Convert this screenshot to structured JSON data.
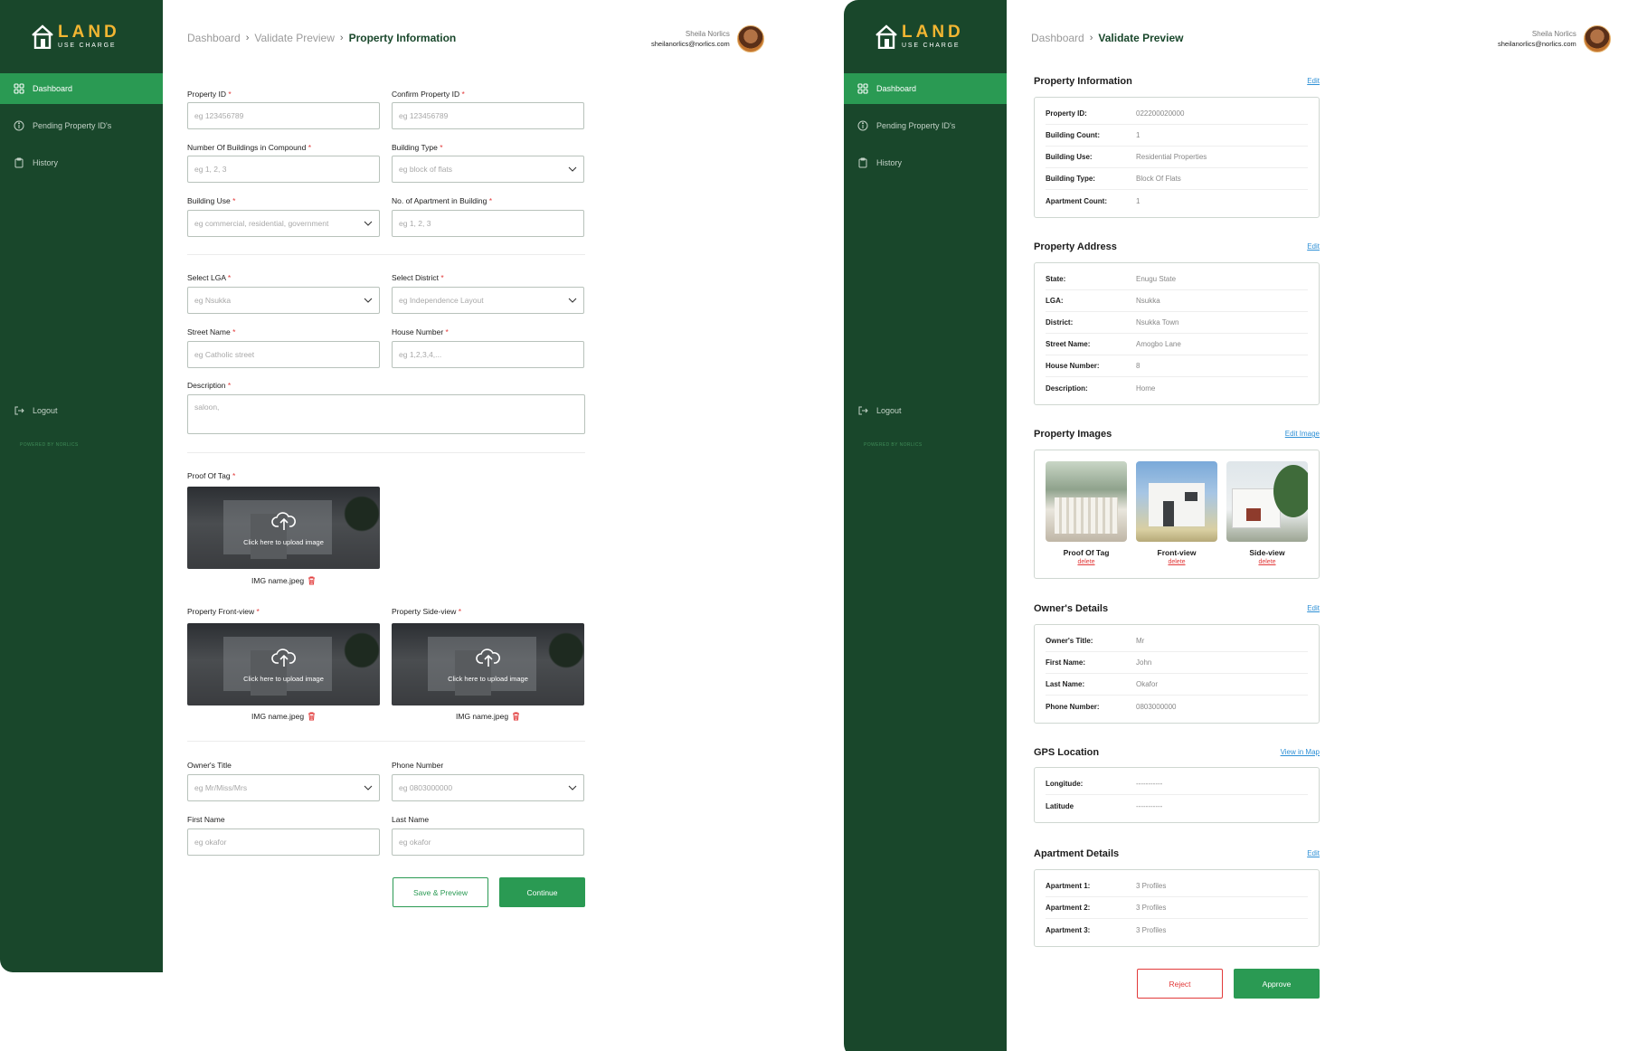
{
  "brand": {
    "title": "LAND",
    "subtitle": "USE CHARGE",
    "powered_by": "POWERED BY NORLICS"
  },
  "sidebar": {
    "items": [
      {
        "label": "Dashboard",
        "icon": "grid-icon"
      },
      {
        "label": "Pending Property ID's",
        "icon": "info-icon"
      },
      {
        "label": "History",
        "icon": "clipboard-icon"
      }
    ],
    "logout": "Logout"
  },
  "user": {
    "name": "Sheila Norlics",
    "email": "sheilanorlics@norlics.com"
  },
  "form_page": {
    "breadcrumb": [
      "Dashboard",
      "Validate Preview",
      "Property Information"
    ],
    "fields": {
      "property_id": {
        "label": "Property ID",
        "placeholder": "eg 123456789"
      },
      "confirm_property_id": {
        "label": "Confirm Property ID",
        "placeholder": "eg 123456789"
      },
      "num_buildings": {
        "label": "Number Of Buildings in Compound",
        "placeholder": "eg 1, 2, 3"
      },
      "building_type": {
        "label": "Building Type",
        "placeholder": "eg block of flats"
      },
      "building_use": {
        "label": "Building Use",
        "placeholder": "eg commercial, residential, government"
      },
      "num_apartments": {
        "label": "No. of Apartment in Building",
        "placeholder": "eg 1, 2, 3"
      },
      "lga": {
        "label": "Select LGA",
        "placeholder": "eg Nsukka"
      },
      "district": {
        "label": "Select District",
        "placeholder": "eg Independence Layout"
      },
      "street": {
        "label": "Street Name",
        "placeholder": "eg Catholic street"
      },
      "house_number": {
        "label": "House Number",
        "placeholder": "eg 1,2,3,4,..."
      },
      "description": {
        "label": "Description",
        "placeholder": "saloon,"
      },
      "owner_title": {
        "label": "Owner's Title",
        "placeholder": "eg Mr/Miss/Mrs"
      },
      "phone": {
        "label": "Phone Number",
        "placeholder": "eg 0803000000"
      },
      "first_name": {
        "label": "First Name",
        "placeholder": "eg okafor"
      },
      "last_name": {
        "label": "Last Name",
        "placeholder": "eg okafor"
      }
    },
    "uploads": {
      "proof_of_tag": {
        "label": "Proof Of Tag",
        "hint": "Click here to upload image",
        "file": "IMG name.jpeg"
      },
      "front_view": {
        "label": "Property Front-view",
        "hint": "Click here to upload image",
        "file": "IMG name.jpeg"
      },
      "side_view": {
        "label": "Property Side-view",
        "hint": "Click here to upload image",
        "file": "IMG name.jpeg"
      }
    },
    "required_mark": "*",
    "buttons": {
      "save_preview": "Save & Preview",
      "continue": "Continue"
    }
  },
  "preview_page": {
    "breadcrumb": [
      "Dashboard",
      "Validate Preview"
    ],
    "property_info": {
      "title": "Property Information",
      "action": "Edit",
      "rows": [
        {
          "k": "Property ID:",
          "v": "022200020000"
        },
        {
          "k": "Building Count:",
          "v": "1"
        },
        {
          "k": "Building Use:",
          "v": "Residential Properties"
        },
        {
          "k": "Building Type:",
          "v": "Block Of Flats"
        },
        {
          "k": "Apartment Count:",
          "v": "1"
        }
      ]
    },
    "property_address": {
      "title": "Property Address",
      "action": "Edit",
      "rows": [
        {
          "k": "State:",
          "v": "Enugu State"
        },
        {
          "k": "LGA:",
          "v": "Nsukka"
        },
        {
          "k": "District:",
          "v": "Nsukka Town"
        },
        {
          "k": "Street Name:",
          "v": "Amogbo Lane"
        },
        {
          "k": "House Number:",
          "v": "8"
        },
        {
          "k": "Description:",
          "v": "Home"
        }
      ]
    },
    "property_images": {
      "title": "Property Images",
      "action": "Edit Image",
      "items": [
        {
          "caption": "Proof Of Tag",
          "delete": "delete"
        },
        {
          "caption": "Front-view",
          "delete": "delete"
        },
        {
          "caption": "Side-view",
          "delete": "delete"
        }
      ]
    },
    "owner_details": {
      "title": "Owner's Details",
      "action": "Edit",
      "rows": [
        {
          "k": "Owner's Title:",
          "v": "Mr"
        },
        {
          "k": "First Name:",
          "v": "John"
        },
        {
          "k": "Last Name:",
          "v": "Okafor"
        },
        {
          "k": "Phone Number:",
          "v": "0803000000"
        }
      ]
    },
    "gps": {
      "title": "GPS Location",
      "action": "View in Map",
      "rows": [
        {
          "k": "Longitude:",
          "v": "-----------"
        },
        {
          "k": "Latitude",
          "v": "-----------"
        }
      ]
    },
    "apartments": {
      "title": "Apartment Details",
      "action": "Edit",
      "rows": [
        {
          "k": "Apartment 1:",
          "v": "3 Profiles"
        },
        {
          "k": "Apartment 2:",
          "v": "3 Profiles"
        },
        {
          "k": "Apartment 3:",
          "v": "3 Profiles"
        }
      ]
    },
    "buttons": {
      "reject": "Reject",
      "approve": "Approve"
    }
  },
  "colors": {
    "sidebar": "#19472b",
    "accent": "#2a9a53",
    "brand_gold": "#f2b632",
    "danger": "#e23a3a",
    "link": "#2e90d6"
  }
}
